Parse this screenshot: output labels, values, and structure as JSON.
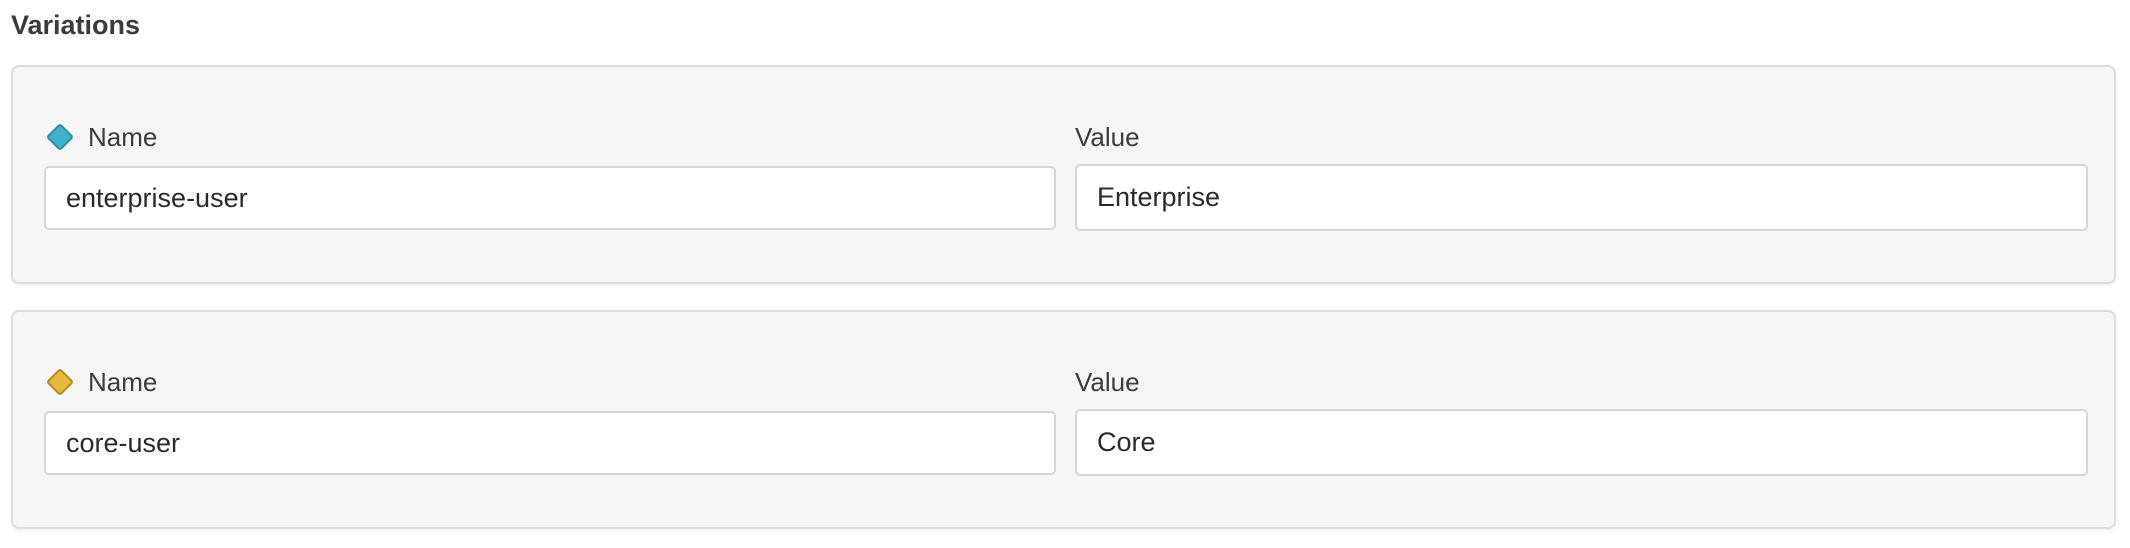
{
  "section": {
    "title": "Variations"
  },
  "variations": [
    {
      "name_label": "Name",
      "value_label": "Value",
      "name": "enterprise-user",
      "value": "Enterprise",
      "color": "#3db2cc",
      "border_color": "#2a8ea5"
    },
    {
      "name_label": "Name",
      "value_label": "Value",
      "name": "core-user",
      "value": "Core",
      "color": "#e8b93a",
      "border_color": "#b48a1e"
    }
  ]
}
